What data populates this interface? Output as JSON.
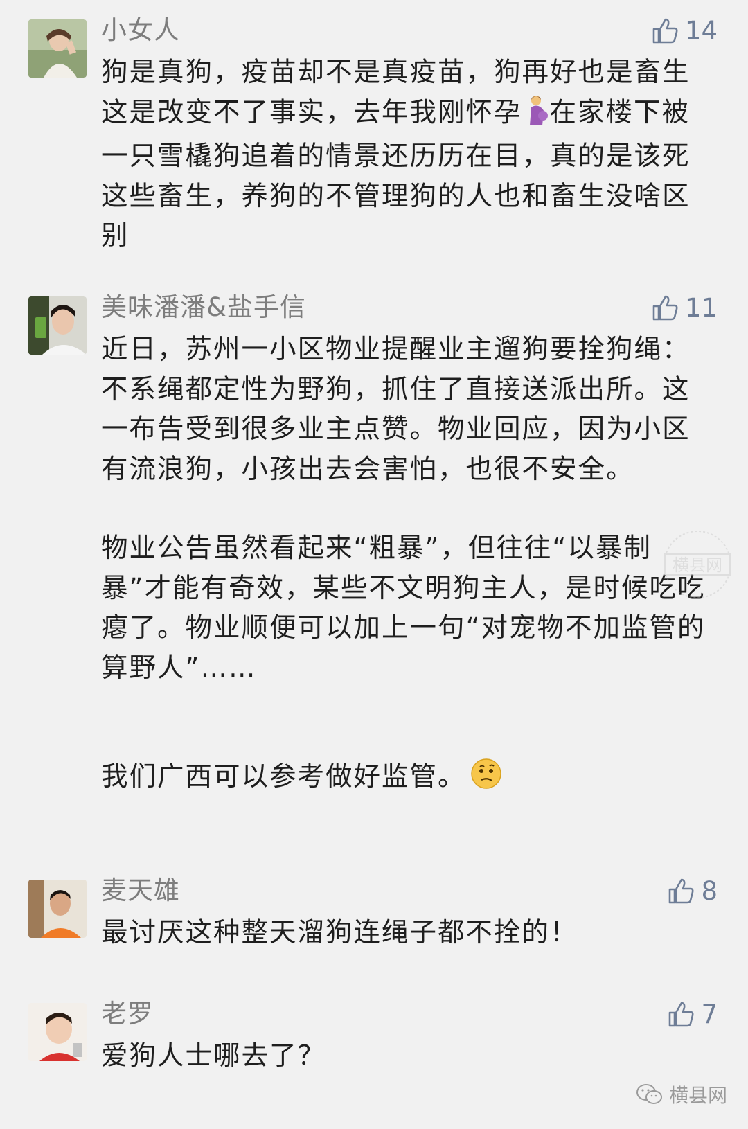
{
  "comments": [
    {
      "name": "小女人",
      "likes": "14",
      "paragraphs": [
        "狗是真狗，疫苗却不是真疫苗，狗再好也是畜生这是改变不了事实，去年我刚怀孕",
        "在家楼下被一只雪橇狗追着的情景还历历在目，真的是该死这些畜生，养狗的不管理狗的人也和畜生没啥区别"
      ],
      "emoji": "pregnant-woman-emoji"
    },
    {
      "name": "美味潘潘&盐手信",
      "likes": "11",
      "paragraphs": [
        "近日，苏州一小区物业提醒业主遛狗要拴狗绳：不系绳都定性为野狗，抓住了直接送派出所。这一布告受到很多业主点赞。物业回应，因为小区有流浪狗，小孩出去会害怕，也很不安全。",
        "物业公告虽然看起来“粗暴”，但往往“以暴制暴”才能有奇效，某些不文明狗主人，是时候吃吃瘪了。物业顺便可以加上一句“对宠物不加监管的算野人”……",
        "我们广西可以参考做好监管。"
      ],
      "emoji": "thinking-face-emoji"
    },
    {
      "name": "麦天雄",
      "likes": "8",
      "paragraphs": [
        "最讨厌这种整天溜狗连绳子都不拴的！"
      ]
    },
    {
      "name": "老罗",
      "likes": "7",
      "paragraphs": [
        "爱狗人士哪去了？"
      ]
    }
  ],
  "footer": {
    "brand": "横县网",
    "icon": "wechat-icon"
  },
  "colors": {
    "background": "#f1f1f1",
    "name": "#7d7d7d",
    "like": "#6e7d96",
    "text": "#1e1e1e"
  }
}
